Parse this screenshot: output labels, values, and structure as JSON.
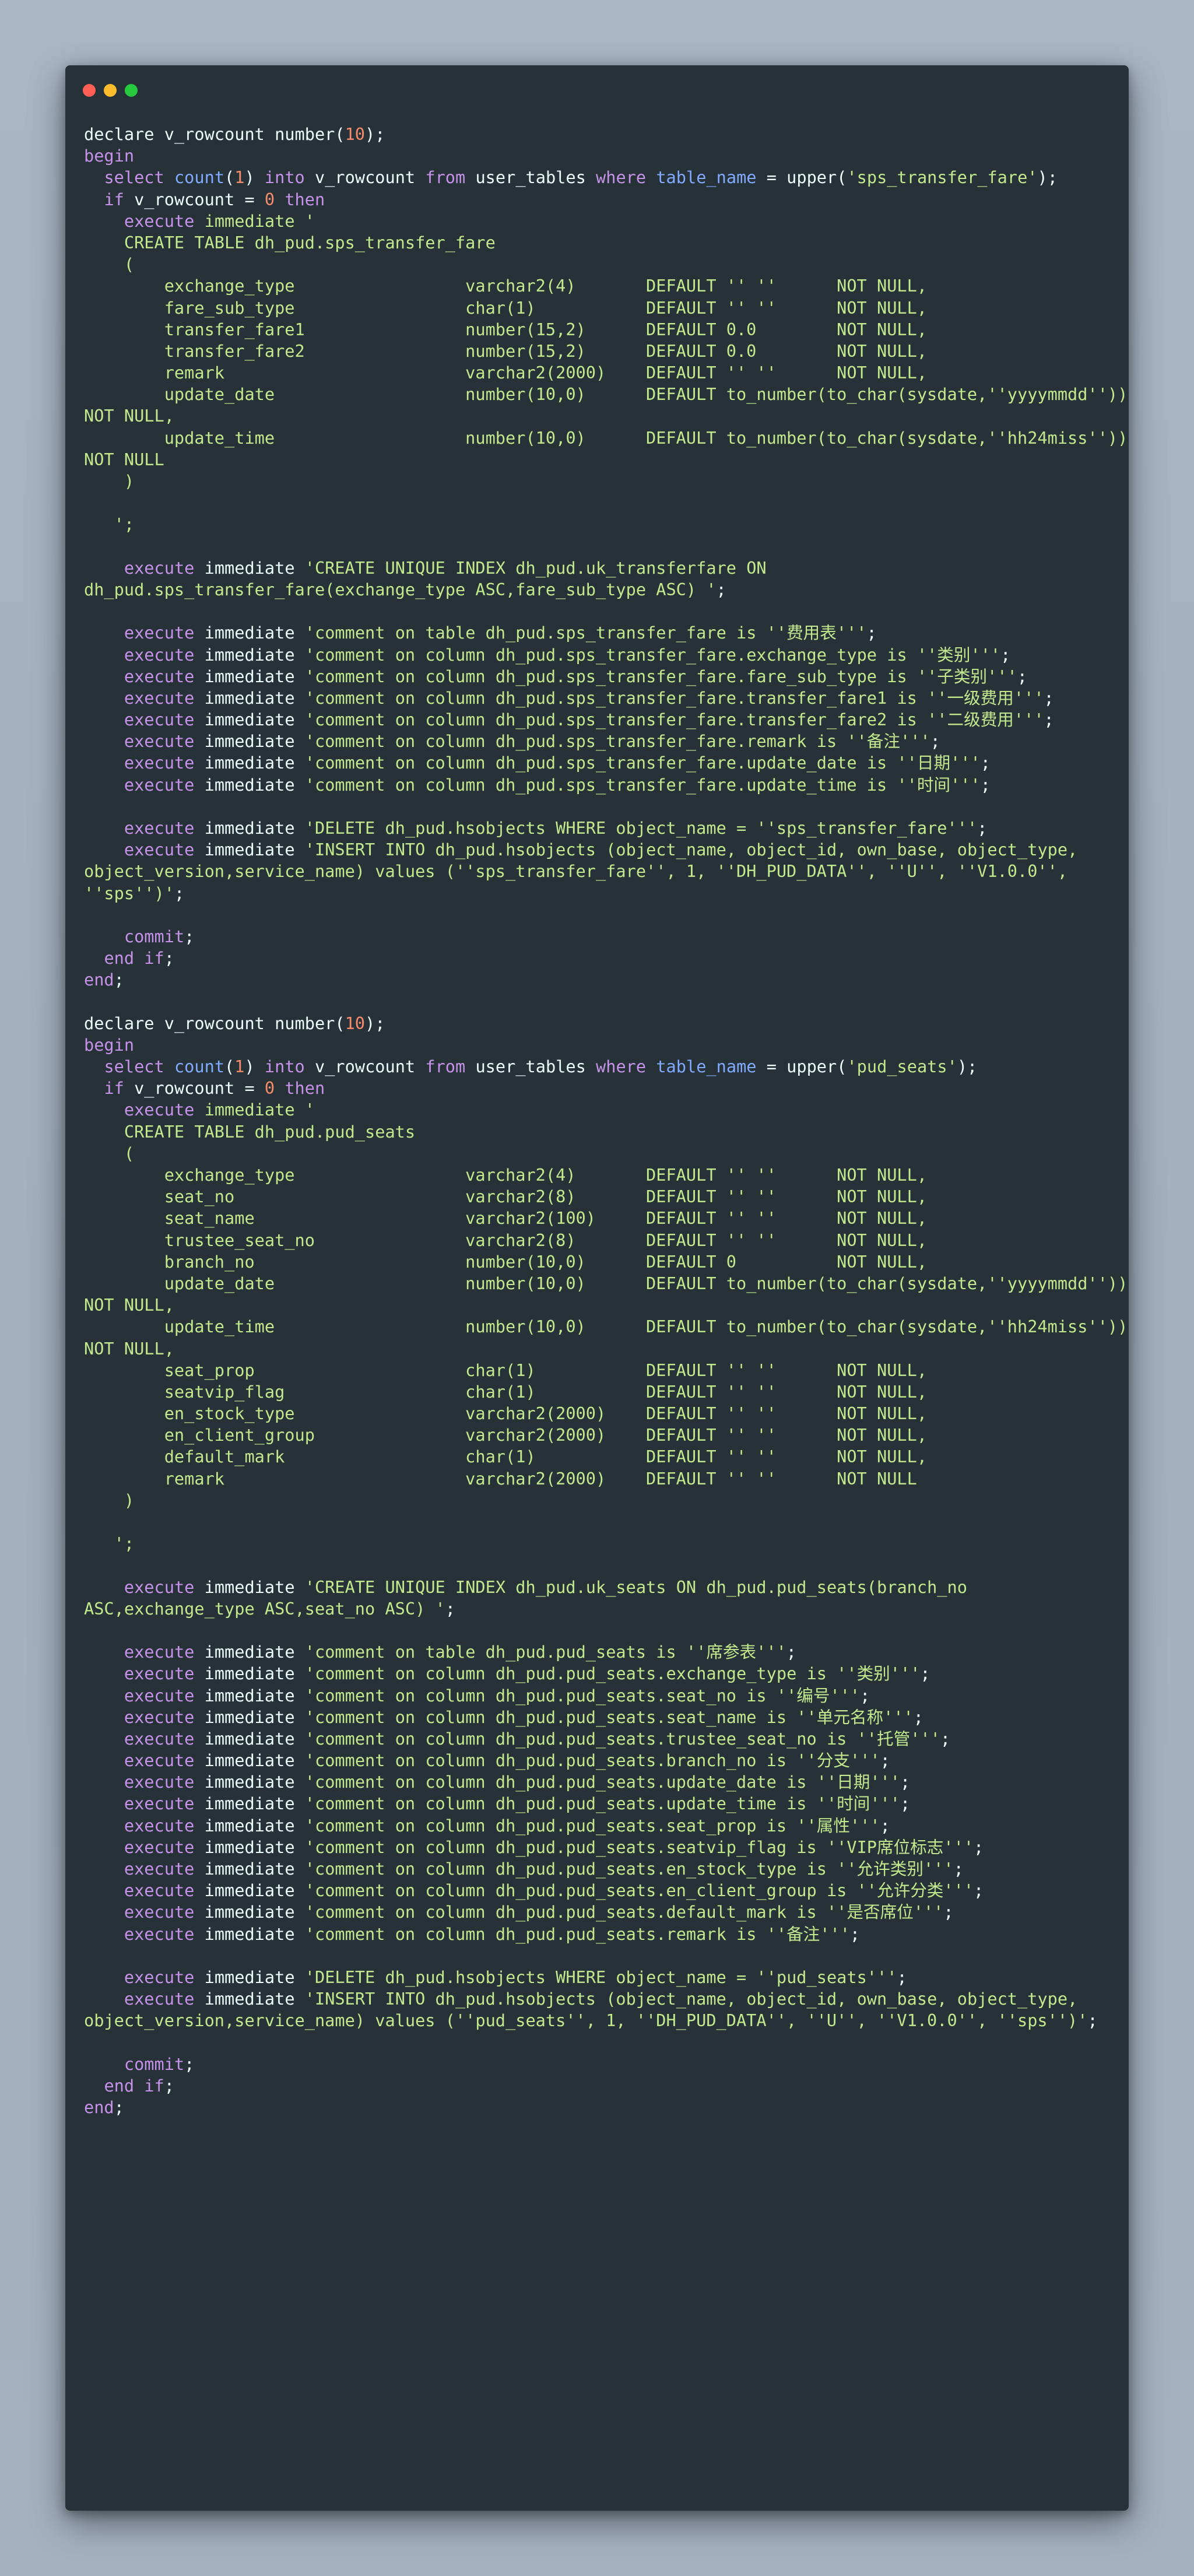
{
  "colors": {
    "background": "#a6b3c3",
    "window": "#263238",
    "close": "#ff5f56",
    "minimize": "#ffbd2e",
    "maximize": "#27c93f",
    "plain": "#eeffff",
    "keyword": "#c792ea",
    "string": "#c3e88d",
    "number": "#f78c6c",
    "function": "#82aaff"
  },
  "code_lines": [
    [
      [
        "plain",
        "declare v_rowcount number("
      ],
      [
        "num",
        "10"
      ],
      [
        "plain",
        ");"
      ]
    ],
    [
      [
        "kw",
        "begin"
      ]
    ],
    [
      [
        "plain",
        "  "
      ],
      [
        "kw",
        "select"
      ],
      [
        "plain",
        " "
      ],
      [
        "fn",
        "count"
      ],
      [
        "plain",
        "("
      ],
      [
        "num",
        "1"
      ],
      [
        "plain",
        ") "
      ],
      [
        "kw",
        "into"
      ],
      [
        "plain",
        " v_rowcount "
      ],
      [
        "kw",
        "from"
      ],
      [
        "plain",
        " user_tables "
      ],
      [
        "kw",
        "where"
      ],
      [
        "plain",
        " "
      ],
      [
        "fn",
        "table_name"
      ],
      [
        "plain",
        " = upper("
      ],
      [
        "str",
        "'sps_transfer_fare'"
      ],
      [
        "plain",
        ");"
      ]
    ],
    [
      [
        "plain",
        "  "
      ],
      [
        "kw",
        "if"
      ],
      [
        "plain",
        " v_rowcount = "
      ],
      [
        "num",
        "0"
      ],
      [
        "plain",
        " "
      ],
      [
        "kw",
        "then"
      ]
    ],
    [
      [
        "plain",
        "    "
      ],
      [
        "kw",
        "execute"
      ],
      [
        "plain",
        " "
      ],
      [
        "str",
        "immediate '"
      ]
    ],
    [
      [
        "str",
        "    CREATE TABLE dh_pud.sps_transfer_fare"
      ]
    ],
    [
      [
        "str",
        "    ("
      ]
    ],
    [
      [
        "str",
        "        exchange_type                 varchar2(4)       DEFAULT '' ''      NOT NULL,"
      ]
    ],
    [
      [
        "str",
        "        fare_sub_type                 char(1)           DEFAULT '' ''      NOT NULL,"
      ]
    ],
    [
      [
        "str",
        "        transfer_fare1                number(15,2)      DEFAULT 0.0        NOT NULL,"
      ]
    ],
    [
      [
        "str",
        "        transfer_fare2                number(15,2)      DEFAULT 0.0        NOT NULL,"
      ]
    ],
    [
      [
        "str",
        "        remark                        varchar2(2000)    DEFAULT '' ''      NOT NULL,"
      ]
    ],
    [
      [
        "str",
        "        update_date                   number(10,0)      DEFAULT to_number(to_char(sysdate,''yyyymmdd''))"
      ]
    ],
    [
      [
        "str",
        "NOT NULL,"
      ]
    ],
    [
      [
        "str",
        "        update_time                   number(10,0)      DEFAULT to_number(to_char(sysdate,''hh24miss''))"
      ]
    ],
    [
      [
        "str",
        "NOT NULL"
      ]
    ],
    [
      [
        "str",
        "    )"
      ]
    ],
    [
      [
        "str",
        ""
      ]
    ],
    [
      [
        "str",
        "   ';"
      ]
    ],
    [
      [
        "plain",
        ""
      ]
    ],
    [
      [
        "plain",
        "    "
      ],
      [
        "kw",
        "execute"
      ],
      [
        "plain",
        " immediate "
      ],
      [
        "str",
        "'CREATE UNIQUE INDEX dh_pud.uk_transferfare ON"
      ]
    ],
    [
      [
        "str",
        "dh_pud.sps_transfer_fare(exchange_type ASC,fare_sub_type ASC) '"
      ],
      [
        "plain",
        ";"
      ]
    ],
    [
      [
        "plain",
        ""
      ]
    ],
    [
      [
        "plain",
        "    "
      ],
      [
        "kw",
        "execute"
      ],
      [
        "plain",
        " immediate "
      ],
      [
        "str",
        "'comment on table dh_pud.sps_transfer_fare is ''费用表'''"
      ],
      [
        "plain",
        ";"
      ]
    ],
    [
      [
        "plain",
        "    "
      ],
      [
        "kw",
        "execute"
      ],
      [
        "plain",
        " immediate "
      ],
      [
        "str",
        "'comment on column dh_pud.sps_transfer_fare.exchange_type is ''类别'''"
      ],
      [
        "plain",
        ";"
      ]
    ],
    [
      [
        "plain",
        "    "
      ],
      [
        "kw",
        "execute"
      ],
      [
        "plain",
        " immediate "
      ],
      [
        "str",
        "'comment on column dh_pud.sps_transfer_fare.fare_sub_type is ''子类别'''"
      ],
      [
        "plain",
        ";"
      ]
    ],
    [
      [
        "plain",
        "    "
      ],
      [
        "kw",
        "execute"
      ],
      [
        "plain",
        " immediate "
      ],
      [
        "str",
        "'comment on column dh_pud.sps_transfer_fare.transfer_fare1 is ''一级费用'''"
      ],
      [
        "plain",
        ";"
      ]
    ],
    [
      [
        "plain",
        "    "
      ],
      [
        "kw",
        "execute"
      ],
      [
        "plain",
        " immediate "
      ],
      [
        "str",
        "'comment on column dh_pud.sps_transfer_fare.transfer_fare2 is ''二级费用'''"
      ],
      [
        "plain",
        ";"
      ]
    ],
    [
      [
        "plain",
        "    "
      ],
      [
        "kw",
        "execute"
      ],
      [
        "plain",
        " immediate "
      ],
      [
        "str",
        "'comment on column dh_pud.sps_transfer_fare.remark is ''备注'''"
      ],
      [
        "plain",
        ";"
      ]
    ],
    [
      [
        "plain",
        "    "
      ],
      [
        "kw",
        "execute"
      ],
      [
        "plain",
        " immediate "
      ],
      [
        "str",
        "'comment on column dh_pud.sps_transfer_fare.update_date is ''日期'''"
      ],
      [
        "plain",
        ";"
      ]
    ],
    [
      [
        "plain",
        "    "
      ],
      [
        "kw",
        "execute"
      ],
      [
        "plain",
        " immediate "
      ],
      [
        "str",
        "'comment on column dh_pud.sps_transfer_fare.update_time is ''时间'''"
      ],
      [
        "plain",
        ";"
      ]
    ],
    [
      [
        "plain",
        ""
      ]
    ],
    [
      [
        "plain",
        "    "
      ],
      [
        "kw",
        "execute"
      ],
      [
        "plain",
        " immediate "
      ],
      [
        "str",
        "'DELETE dh_pud.hsobjects WHERE object_name = ''sps_transfer_fare'''"
      ],
      [
        "plain",
        ";"
      ]
    ],
    [
      [
        "plain",
        "    "
      ],
      [
        "kw",
        "execute"
      ],
      [
        "plain",
        " immediate "
      ],
      [
        "str",
        "'INSERT INTO dh_pud.hsobjects (object_name, object_id, own_base, object_type,"
      ]
    ],
    [
      [
        "str",
        "object_version,service_name) values (''sps_transfer_fare'', 1, ''DH_PUD_DATA'', ''U'', ''V1.0.0'',"
      ]
    ],
    [
      [
        "str",
        "''sps'')'"
      ],
      [
        "plain",
        ";"
      ]
    ],
    [
      [
        "plain",
        ""
      ]
    ],
    [
      [
        "plain",
        "    "
      ],
      [
        "kw",
        "commit"
      ],
      [
        "plain",
        ";"
      ]
    ],
    [
      [
        "plain",
        "  "
      ],
      [
        "kw",
        "end if"
      ],
      [
        "plain",
        ";"
      ]
    ],
    [
      [
        "kw",
        "end"
      ],
      [
        "plain",
        ";"
      ]
    ],
    [
      [
        "plain",
        ""
      ]
    ],
    [
      [
        "plain",
        "declare v_rowcount number("
      ],
      [
        "num",
        "10"
      ],
      [
        "plain",
        ");"
      ]
    ],
    [
      [
        "kw",
        "begin"
      ]
    ],
    [
      [
        "plain",
        "  "
      ],
      [
        "kw",
        "select"
      ],
      [
        "plain",
        " "
      ],
      [
        "fn",
        "count"
      ],
      [
        "plain",
        "("
      ],
      [
        "num",
        "1"
      ],
      [
        "plain",
        ") "
      ],
      [
        "kw",
        "into"
      ],
      [
        "plain",
        " v_rowcount "
      ],
      [
        "kw",
        "from"
      ],
      [
        "plain",
        " user_tables "
      ],
      [
        "kw",
        "where"
      ],
      [
        "plain",
        " "
      ],
      [
        "fn",
        "table_name"
      ],
      [
        "plain",
        " = upper("
      ],
      [
        "str",
        "'pud_seats'"
      ],
      [
        "plain",
        ");"
      ]
    ],
    [
      [
        "plain",
        "  "
      ],
      [
        "kw",
        "if"
      ],
      [
        "plain",
        " v_rowcount = "
      ],
      [
        "num",
        "0"
      ],
      [
        "plain",
        " "
      ],
      [
        "kw",
        "then"
      ]
    ],
    [
      [
        "plain",
        "    "
      ],
      [
        "kw",
        "execute"
      ],
      [
        "plain",
        " "
      ],
      [
        "str",
        "immediate '"
      ]
    ],
    [
      [
        "str",
        "    CREATE TABLE dh_pud.pud_seats"
      ]
    ],
    [
      [
        "str",
        "    ("
      ]
    ],
    [
      [
        "str",
        "        exchange_type                 varchar2(4)       DEFAULT '' ''      NOT NULL,"
      ]
    ],
    [
      [
        "str",
        "        seat_no                       varchar2(8)       DEFAULT '' ''      NOT NULL,"
      ]
    ],
    [
      [
        "str",
        "        seat_name                     varchar2(100)     DEFAULT '' ''      NOT NULL,"
      ]
    ],
    [
      [
        "str",
        "        trustee_seat_no               varchar2(8)       DEFAULT '' ''      NOT NULL,"
      ]
    ],
    [
      [
        "str",
        "        branch_no                     number(10,0)      DEFAULT 0          NOT NULL,"
      ]
    ],
    [
      [
        "str",
        "        update_date                   number(10,0)      DEFAULT to_number(to_char(sysdate,''yyyymmdd''))"
      ]
    ],
    [
      [
        "str",
        "NOT NULL,"
      ]
    ],
    [
      [
        "str",
        "        update_time                   number(10,0)      DEFAULT to_number(to_char(sysdate,''hh24miss''))"
      ]
    ],
    [
      [
        "str",
        "NOT NULL,"
      ]
    ],
    [
      [
        "str",
        "        seat_prop                     char(1)           DEFAULT '' ''      NOT NULL,"
      ]
    ],
    [
      [
        "str",
        "        seatvip_flag                  char(1)           DEFAULT '' ''      NOT NULL,"
      ]
    ],
    [
      [
        "str",
        "        en_stock_type                 varchar2(2000)    DEFAULT '' ''      NOT NULL,"
      ]
    ],
    [
      [
        "str",
        "        en_client_group               varchar2(2000)    DEFAULT '' ''      NOT NULL,"
      ]
    ],
    [
      [
        "str",
        "        default_mark                  char(1)           DEFAULT '' ''      NOT NULL,"
      ]
    ],
    [
      [
        "str",
        "        remark                        varchar2(2000)    DEFAULT '' ''      NOT NULL"
      ]
    ],
    [
      [
        "str",
        "    )"
      ]
    ],
    [
      [
        "str",
        ""
      ]
    ],
    [
      [
        "str",
        "   ';"
      ]
    ],
    [
      [
        "plain",
        ""
      ]
    ],
    [
      [
        "plain",
        "    "
      ],
      [
        "kw",
        "execute"
      ],
      [
        "plain",
        " immediate "
      ],
      [
        "str",
        "'CREATE UNIQUE INDEX dh_pud.uk_seats ON dh_pud.pud_seats(branch_no"
      ]
    ],
    [
      [
        "str",
        "ASC,exchange_type ASC,seat_no ASC) '"
      ],
      [
        "plain",
        ";"
      ]
    ],
    [
      [
        "plain",
        ""
      ]
    ],
    [
      [
        "plain",
        "    "
      ],
      [
        "kw",
        "execute"
      ],
      [
        "plain",
        " immediate "
      ],
      [
        "str",
        "'comment on table dh_pud.pud_seats is ''席参表'''"
      ],
      [
        "plain",
        ";"
      ]
    ],
    [
      [
        "plain",
        "    "
      ],
      [
        "kw",
        "execute"
      ],
      [
        "plain",
        " immediate "
      ],
      [
        "str",
        "'comment on column dh_pud.pud_seats.exchange_type is ''类别'''"
      ],
      [
        "plain",
        ";"
      ]
    ],
    [
      [
        "plain",
        "    "
      ],
      [
        "kw",
        "execute"
      ],
      [
        "plain",
        " immediate "
      ],
      [
        "str",
        "'comment on column dh_pud.pud_seats.seat_no is ''编号'''"
      ],
      [
        "plain",
        ";"
      ]
    ],
    [
      [
        "plain",
        "    "
      ],
      [
        "kw",
        "execute"
      ],
      [
        "plain",
        " immediate "
      ],
      [
        "str",
        "'comment on column dh_pud.pud_seats.seat_name is ''单元名称'''"
      ],
      [
        "plain",
        ";"
      ]
    ],
    [
      [
        "plain",
        "    "
      ],
      [
        "kw",
        "execute"
      ],
      [
        "plain",
        " immediate "
      ],
      [
        "str",
        "'comment on column dh_pud.pud_seats.trustee_seat_no is ''托管'''"
      ],
      [
        "plain",
        ";"
      ]
    ],
    [
      [
        "plain",
        "    "
      ],
      [
        "kw",
        "execute"
      ],
      [
        "plain",
        " immediate "
      ],
      [
        "str",
        "'comment on column dh_pud.pud_seats.branch_no is ''分支'''"
      ],
      [
        "plain",
        ";"
      ]
    ],
    [
      [
        "plain",
        "    "
      ],
      [
        "kw",
        "execute"
      ],
      [
        "plain",
        " immediate "
      ],
      [
        "str",
        "'comment on column dh_pud.pud_seats.update_date is ''日期'''"
      ],
      [
        "plain",
        ";"
      ]
    ],
    [
      [
        "plain",
        "    "
      ],
      [
        "kw",
        "execute"
      ],
      [
        "plain",
        " immediate "
      ],
      [
        "str",
        "'comment on column dh_pud.pud_seats.update_time is ''时间'''"
      ],
      [
        "plain",
        ";"
      ]
    ],
    [
      [
        "plain",
        "    "
      ],
      [
        "kw",
        "execute"
      ],
      [
        "plain",
        " immediate "
      ],
      [
        "str",
        "'comment on column dh_pud.pud_seats.seat_prop is ''属性'''"
      ],
      [
        "plain",
        ";"
      ]
    ],
    [
      [
        "plain",
        "    "
      ],
      [
        "kw",
        "execute"
      ],
      [
        "plain",
        " immediate "
      ],
      [
        "str",
        "'comment on column dh_pud.pud_seats.seatvip_flag is ''VIP席位标志'''"
      ],
      [
        "plain",
        ";"
      ]
    ],
    [
      [
        "plain",
        "    "
      ],
      [
        "kw",
        "execute"
      ],
      [
        "plain",
        " immediate "
      ],
      [
        "str",
        "'comment on column dh_pud.pud_seats.en_stock_type is ''允许类别'''"
      ],
      [
        "plain",
        ";"
      ]
    ],
    [
      [
        "plain",
        "    "
      ],
      [
        "kw",
        "execute"
      ],
      [
        "plain",
        " immediate "
      ],
      [
        "str",
        "'comment on column dh_pud.pud_seats.en_client_group is ''允许分类'''"
      ],
      [
        "plain",
        ";"
      ]
    ],
    [
      [
        "plain",
        "    "
      ],
      [
        "kw",
        "execute"
      ],
      [
        "plain",
        " immediate "
      ],
      [
        "str",
        "'comment on column dh_pud.pud_seats.default_mark is ''是否席位'''"
      ],
      [
        "plain",
        ";"
      ]
    ],
    [
      [
        "plain",
        "    "
      ],
      [
        "kw",
        "execute"
      ],
      [
        "plain",
        " immediate "
      ],
      [
        "str",
        "'comment on column dh_pud.pud_seats.remark is ''备注'''"
      ],
      [
        "plain",
        ";"
      ]
    ],
    [
      [
        "plain",
        ""
      ]
    ],
    [
      [
        "plain",
        "    "
      ],
      [
        "kw",
        "execute"
      ],
      [
        "plain",
        " immediate "
      ],
      [
        "str",
        "'DELETE dh_pud.hsobjects WHERE object_name = ''pud_seats'''"
      ],
      [
        "plain",
        ";"
      ]
    ],
    [
      [
        "plain",
        "    "
      ],
      [
        "kw",
        "execute"
      ],
      [
        "plain",
        " immediate "
      ],
      [
        "str",
        "'INSERT INTO dh_pud.hsobjects (object_name, object_id, own_base, object_type,"
      ]
    ],
    [
      [
        "str",
        "object_version,service_name) values (''pud_seats'', 1, ''DH_PUD_DATA'', ''U'', ''V1.0.0'', ''sps'')'"
      ],
      [
        "plain",
        ";"
      ]
    ],
    [
      [
        "plain",
        ""
      ]
    ],
    [
      [
        "plain",
        "    "
      ],
      [
        "kw",
        "commit"
      ],
      [
        "plain",
        ";"
      ]
    ],
    [
      [
        "plain",
        "  "
      ],
      [
        "kw",
        "end if"
      ],
      [
        "plain",
        ";"
      ]
    ],
    [
      [
        "kw",
        "end"
      ],
      [
        "plain",
        ";"
      ]
    ]
  ]
}
